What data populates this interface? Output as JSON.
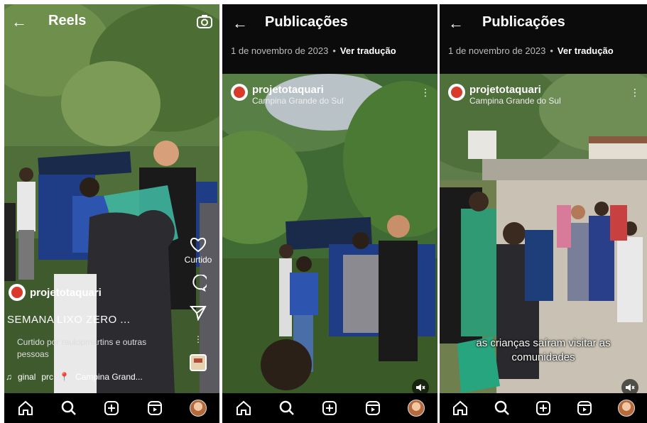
{
  "reel": {
    "title": "Reels",
    "author": "projetotaquari",
    "caption": "SEMANA LIXO ZERO ...",
    "liked_by": "Curtido por raulopmartins e outras pessoas",
    "like_label": "Curtido",
    "audio_label": "ginal",
    "audio_author": "prc",
    "location": "Campina Grand...",
    "progress": 0.75
  },
  "post1": {
    "title": "Publicações",
    "date": "1 de novembro de 2023",
    "separator": "•",
    "translate": "Ver tradução",
    "author": "projetotaquari",
    "location": "Campina Grande do Sul"
  },
  "post2": {
    "title": "Publicações",
    "date": "1 de novembro de 2023",
    "separator": "•",
    "translate": "Ver tradução",
    "author": "projetotaquari",
    "location": "Campina Grande do Sul",
    "subtitle_line1": "as crianças saíram visitar as",
    "subtitle_line2": "comunidades"
  },
  "nav_icons": [
    "home-icon",
    "search-icon",
    "create-icon",
    "reels-icon",
    "profile-avatar"
  ],
  "colors": {
    "background": "#000000",
    "accent": "#ffffff",
    "secondary": "#bbbbbb"
  }
}
